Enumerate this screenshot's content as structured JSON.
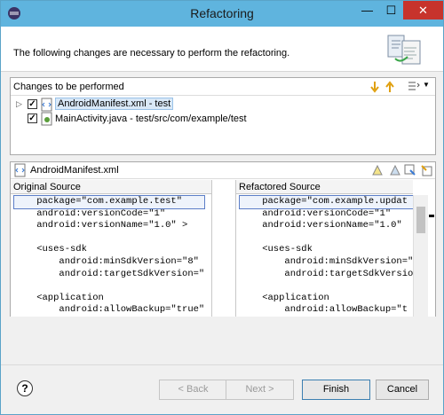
{
  "window": {
    "title": "Refactoring",
    "minimize": "—",
    "maximize": "☐",
    "close": "✕"
  },
  "header": {
    "message": "The following changes are necessary to perform the refactoring."
  },
  "changes": {
    "label": "Changes to be performed",
    "items": [
      {
        "label": "AndroidManifest.xml - test",
        "checked": true,
        "expanded": false
      },
      {
        "label": "MainActivity.java - test/src/com/example/test",
        "checked": true
      }
    ]
  },
  "compare": {
    "file": "AndroidManifest.xml",
    "original": {
      "title": "Original Source",
      "lines": [
        "    package=\"com.example.test\"",
        "    android:versionCode=\"1\"",
        "    android:versionName=\"1.0\" >",
        "",
        "    <uses-sdk",
        "        android:minSdkVersion=\"8\"",
        "        android:targetSdkVersion=\"",
        "",
        "    <application",
        "        android:allowBackup=\"true\""
      ]
    },
    "refactored": {
      "title": "Refactored Source",
      "lines": [
        "    package=\"com.example.updat",
        "    android:versionCode=\"1\"",
        "    android:versionName=\"1.0\"",
        "",
        "    <uses-sdk",
        "        android:minSdkVersion=\"",
        "        android:targetSdkVersio",
        "",
        "    <application",
        "        android:allowBackup=\"t"
      ]
    }
  },
  "buttons": {
    "help": "?",
    "back": "< Back",
    "next": "Next >",
    "finish": "Finish",
    "cancel": "Cancel"
  }
}
